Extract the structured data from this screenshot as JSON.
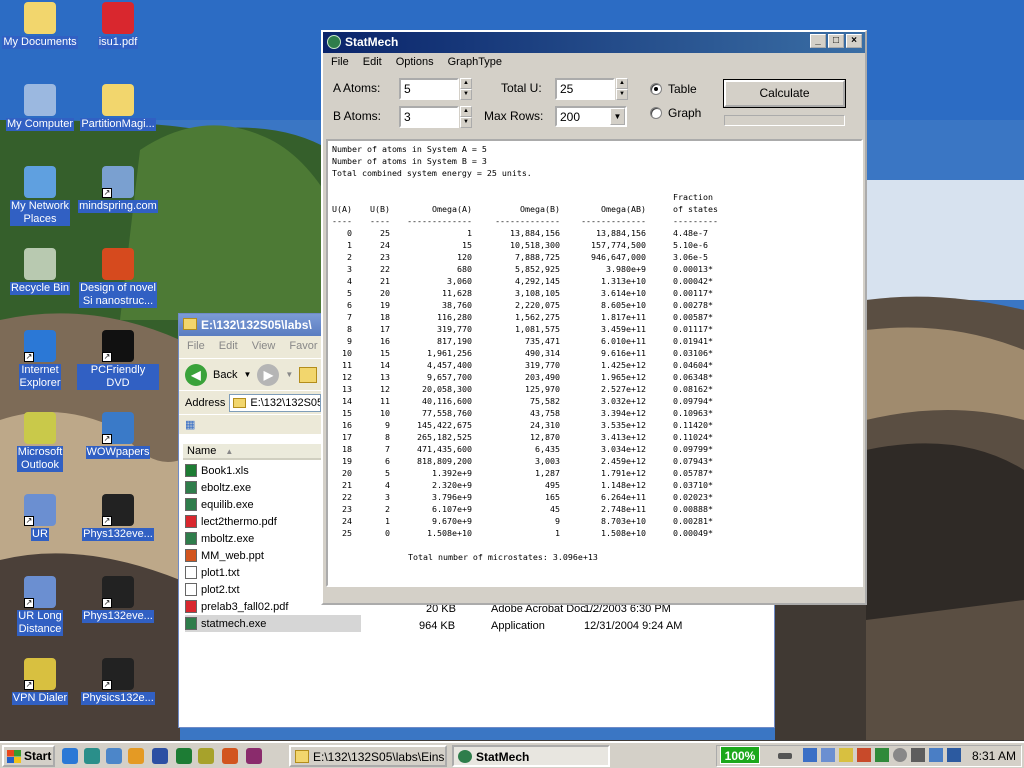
{
  "desktop": {
    "icons": [
      {
        "label": "My Documents"
      },
      {
        "label": "isu1.pdf"
      },
      {
        "label": "My Computer"
      },
      {
        "label": "PartitionMagi..."
      },
      {
        "label": "My Network\nPlaces"
      },
      {
        "label": "mindspring.com"
      },
      {
        "label": "Recycle Bin"
      },
      {
        "label": "Design of novel\nSi nanostruc..."
      },
      {
        "label": "Internet\nExplorer"
      },
      {
        "label": "PCFriendly DVD"
      },
      {
        "label": "Microsoft\nOutlook"
      },
      {
        "label": "WOWpapers"
      },
      {
        "label": "UR"
      },
      {
        "label": "Phys132eve..."
      },
      {
        "label": "UR Long\nDistance"
      },
      {
        "label": "Phys132eve..."
      },
      {
        "label": "VPN Dialer"
      },
      {
        "label": "Physics132e..."
      }
    ]
  },
  "explorer": {
    "title": "E:\\132\\132S05\\labs\\",
    "menu": [
      "File",
      "Edit",
      "View",
      "Favor"
    ],
    "back_label": "Back",
    "address_label": "Address",
    "address_value": "E:\\132\\132S05",
    "name_header": "Name",
    "files": [
      {
        "name": "Book1.xls",
        "icon": "excel-icon"
      },
      {
        "name": "eboltz.exe",
        "icon": "exe-icon"
      },
      {
        "name": "equilib.exe",
        "icon": "exe-icon"
      },
      {
        "name": "lect2thermo.pdf",
        "icon": "pdf-icon"
      },
      {
        "name": "mboltz.exe",
        "icon": "exe-icon"
      },
      {
        "name": "MM_web.ppt",
        "icon": "ppt-icon"
      },
      {
        "name": "plot1.txt",
        "icon": "txt-icon"
      },
      {
        "name": "plot2.txt",
        "icon": "txt-icon"
      },
      {
        "name": "prelab3_fall02.pdf",
        "icon": "pdf-icon"
      },
      {
        "name": "statmech.exe",
        "icon": "exe-icon"
      }
    ],
    "detail_partial": {
      "size": "20 KB",
      "type": "Adobe Acrobat Doc...",
      "date": "1/2/2003 6:30 PM"
    },
    "detail_statmech": {
      "size": "964 KB",
      "type": "Application",
      "date": "12/31/2004 9:24 AM"
    }
  },
  "statmech": {
    "title": "StatMech",
    "menu": [
      "File",
      "Edit",
      "Options",
      "GraphType"
    ],
    "a_atoms_label": "A Atoms:",
    "a_atoms_value": "5",
    "b_atoms_label": "B Atoms:",
    "b_atoms_value": "3",
    "total_u_label": "Total U:",
    "total_u_value": "25",
    "max_rows_label": "Max Rows:",
    "max_rows_value": "200",
    "radio_table": "Table",
    "radio_graph": "Graph",
    "selected_mode": "Table",
    "calculate_label": "Calculate",
    "output": {
      "header_lines": [
        "Number of atoms in System A = 5",
        "Number of atoms in System B = 3",
        "Total combined system energy = 25 units."
      ],
      "col_headers": [
        "U(A)",
        "U(B)",
        "Omega(A)",
        "Omega(B)",
        "Omega(AB)",
        "Fraction\nof states"
      ],
      "dashes": [
        "----",
        "----",
        "-------------",
        "-------------",
        "-------------",
        "---------"
      ],
      "rows": [
        [
          "0",
          "25",
          "1",
          "13,884,156",
          "13,884,156",
          "4.48e-7"
        ],
        [
          "1",
          "24",
          "15",
          "10,518,300",
          "157,774,500",
          "5.10e-6"
        ],
        [
          "2",
          "23",
          "120",
          "7,888,725",
          "946,647,000",
          "3.06e-5"
        ],
        [
          "3",
          "22",
          "680",
          "5,852,925",
          "3.980e+9",
          "0.00013*"
        ],
        [
          "4",
          "21",
          "3,060",
          "4,292,145",
          "1.313e+10",
          "0.00042*"
        ],
        [
          "5",
          "20",
          "11,628",
          "3,108,105",
          "3.614e+10",
          "0.00117*"
        ],
        [
          "6",
          "19",
          "38,760",
          "2,220,075",
          "8.605e+10",
          "0.00278*"
        ],
        [
          "7",
          "18",
          "116,280",
          "1,562,275",
          "1.817e+11",
          "0.00587*"
        ],
        [
          "8",
          "17",
          "319,770",
          "1,081,575",
          "3.459e+11",
          "0.01117*"
        ],
        [
          "9",
          "16",
          "817,190",
          "735,471",
          "6.010e+11",
          "0.01941*"
        ],
        [
          "10",
          "15",
          "1,961,256",
          "490,314",
          "9.616e+11",
          "0.03106*"
        ],
        [
          "11",
          "14",
          "4,457,400",
          "319,770",
          "1.425e+12",
          "0.04604*"
        ],
        [
          "12",
          "13",
          "9,657,700",
          "203,490",
          "1.965e+12",
          "0.06348*"
        ],
        [
          "13",
          "12",
          "20,058,300",
          "125,970",
          "2.527e+12",
          "0.08162*"
        ],
        [
          "14",
          "11",
          "40,116,600",
          "75,582",
          "3.032e+12",
          "0.09794*"
        ],
        [
          "15",
          "10",
          "77,558,760",
          "43,758",
          "3.394e+12",
          "0.10963*"
        ],
        [
          "16",
          "9",
          "145,422,675",
          "24,310",
          "3.535e+12",
          "0.11420*"
        ],
        [
          "17",
          "8",
          "265,182,525",
          "12,870",
          "3.413e+12",
          "0.11024*"
        ],
        [
          "18",
          "7",
          "471,435,600",
          "6,435",
          "3.034e+12",
          "0.09799*"
        ],
        [
          "19",
          "6",
          "818,809,200",
          "3,003",
          "2.459e+12",
          "0.07943*"
        ],
        [
          "20",
          "5",
          "1.392e+9",
          "1,287",
          "1.791e+12",
          "0.05787*"
        ],
        [
          "21",
          "4",
          "2.320e+9",
          "495",
          "1.148e+12",
          "0.03710*"
        ],
        [
          "22",
          "3",
          "3.796e+9",
          "165",
          "6.264e+11",
          "0.02023*"
        ],
        [
          "23",
          "2",
          "6.107e+9",
          "45",
          "2.748e+11",
          "0.00888*"
        ],
        [
          "24",
          "1",
          "9.670e+9",
          "9",
          "8.703e+10",
          "0.00281*"
        ],
        [
          "25",
          "0",
          "1.508e+10",
          "1",
          "1.508e+10",
          "0.00049*"
        ]
      ],
      "total_line": "Total number of microstates: 3.096e+13"
    }
  },
  "taskbar": {
    "start_label": "Start",
    "tasks": [
      {
        "label": "E:\\132\\132S05\\labs\\Eins...",
        "active": false
      },
      {
        "label": "StatMech",
        "active": true
      }
    ],
    "zoom": "100%",
    "clock": "8:31 AM"
  },
  "colors": {
    "titlebar_active": "#0a246a",
    "titlebar_inactive": "#7c9bd6",
    "selection": "#3160c3"
  }
}
